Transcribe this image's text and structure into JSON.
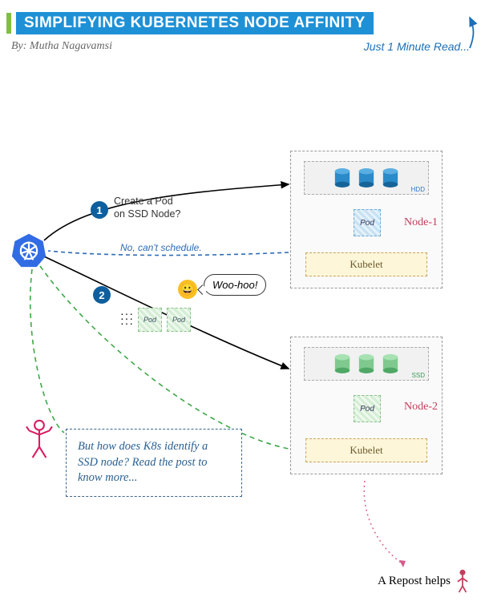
{
  "header": {
    "title": "SIMPLIFYING KUBERNETES NODE AFFINITY",
    "byline": "By: Mutha Nagavamsi",
    "readtime": "Just 1 Minute Read..."
  },
  "steps": {
    "one": {
      "num": "1",
      "label": "Create a Pod on SSD Node?",
      "reply": "No, can't schedule."
    },
    "two": {
      "num": "2",
      "exclaim": "Woo-hoo!"
    }
  },
  "nodes": {
    "n1": {
      "name": "Node-1",
      "diskTag": "HDD",
      "podLabel": "Pod",
      "kubelet": "Kubelet"
    },
    "n2": {
      "name": "Node-2",
      "diskTag": "SSD",
      "podLabel": "Pod",
      "kubelet": "Kubelet"
    }
  },
  "miniPodLabel": "Pod",
  "callout": "But how does K8s identify a SSD node? Read the post to know more...",
  "footer": {
    "repost": "A Repost helps"
  },
  "colors": {
    "hdd": "#2b8ac9",
    "ssd": "#7fc98f"
  }
}
